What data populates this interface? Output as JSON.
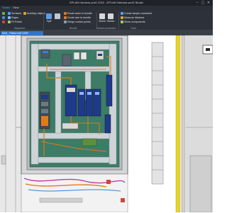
{
  "window": {
    "title": "EPLAN Harness proD 2022 - EPLAN Harness proD Studio",
    "controls": [
      "–",
      "▢",
      "✕"
    ]
  },
  "menu": {
    "items": [
      "Studio",
      "View"
    ],
    "active_index": 0
  },
  "ribbon": {
    "surface_tools": [
      {
        "label": "Surfaces",
        "icon": "surfaces-icon"
      },
      {
        "label": "Edges",
        "icon": "edges-icon"
      },
      {
        "label": "Fit Points",
        "icon": "fit-points-icon"
      }
    ],
    "auxiliary_objects_label": "Auxiliary objects",
    "split_label": "Split",
    "bundle_tools": [
      {
        "label": "Route wires to bundle",
        "icon": "route-wires-icon"
      },
      {
        "label": "Route wire to bundle",
        "icon": "route-wire-icon"
      },
      {
        "label": "Merge control points",
        "icon": "merge-icon"
      }
    ],
    "shrink_label": "Shrink",
    "stretch_label": "Stretch",
    "right_tools": [
      {
        "label": "Create simple constraint",
        "icon": "constraint-icon"
      },
      {
        "label": "Measure distance",
        "icon": "measure-icon"
      },
      {
        "label": "Show components",
        "icon": "components-icon"
      }
    ],
    "groups": [
      "Alignment",
      "Bundle",
      "Surface protection",
      "Tools"
    ]
  },
  "document_tab": {
    "label": "BAS_ PlatformAT1009*"
  },
  "colors": {
    "ribbon_bg": "#2d3139",
    "tab_active": "#2f76c9",
    "cabinet_panel": "#3d7c66",
    "wire": "#e27a1c",
    "devices": "#1f3a8a"
  }
}
